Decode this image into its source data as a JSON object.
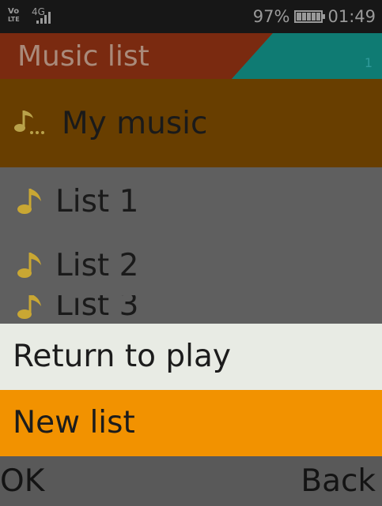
{
  "status_bar": {
    "volte_top": "Vo",
    "volte_bottom": "LTE",
    "network": "4G",
    "battery_percent": "97%",
    "time": "01:49",
    "icons": [
      "volte-icon",
      "signal-icon",
      "battery-icon"
    ]
  },
  "header": {
    "title": "Music list",
    "page_number": "1",
    "colors": {
      "title_bg": "#7a2a10",
      "accent": "#0f7b73"
    }
  },
  "list": {
    "items": [
      {
        "label": "My music",
        "icon": "music-folder-icon",
        "selected": true
      },
      {
        "label": "List 1",
        "icon": "music-note-icon"
      },
      {
        "label": "List 2",
        "icon": "music-note-icon"
      },
      {
        "label": "List 3",
        "icon": "music-note-icon"
      }
    ]
  },
  "options_menu": {
    "items": [
      {
        "label": "Return to play"
      },
      {
        "label": "New list",
        "highlighted": true
      }
    ],
    "highlight_color": "#f29200"
  },
  "softkeys": {
    "left": "OK",
    "right": "Back"
  }
}
